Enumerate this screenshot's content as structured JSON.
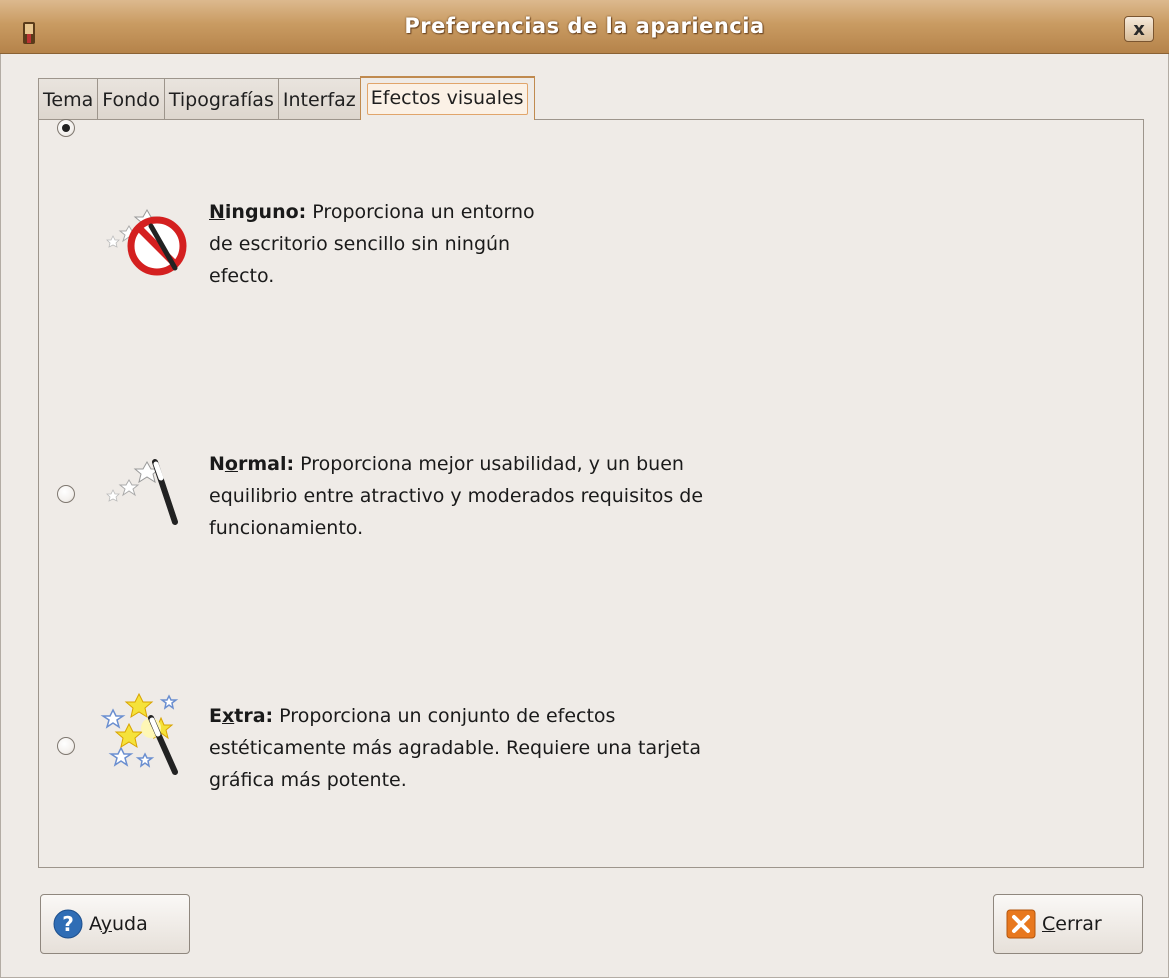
{
  "window": {
    "title": "Preferencias de la apariencia",
    "close_label": "x"
  },
  "tabs": [
    {
      "label": "Tema"
    },
    {
      "label": "Fondo"
    },
    {
      "label": "Tipografías"
    },
    {
      "label": "Interfaz"
    },
    {
      "label": "Efectos visuales",
      "active": true
    }
  ],
  "options": [
    {
      "name_pre": "",
      "name_mnemonic": "N",
      "name_post": "inguno:",
      "lines": [
        "Proporciona un entorno",
        "de escritorio sencillo sin ningún",
        "efecto."
      ],
      "selected": true,
      "icon": "wand-disabled-icon"
    },
    {
      "name_pre": "N",
      "name_mnemonic": "o",
      "name_post": "rmal:",
      "lines": [
        "Proporciona mejor usabilidad, y un buen",
        "equilibrio entre atractivo y moderados requisitos de",
        "funcionamiento."
      ],
      "selected": false,
      "icon": "wand-normal-icon"
    },
    {
      "name_pre": "E",
      "name_mnemonic": "x",
      "name_post": "tra:",
      "lines": [
        "Proporciona un conjunto de efectos",
        "estéticamente más agradable. Requiere una tarjeta",
        "gráfica más potente."
      ],
      "selected": false,
      "icon": "wand-extra-icon"
    }
  ],
  "buttons": {
    "help": {
      "pre": "A",
      "mnemonic": "y",
      "post": "uda",
      "icon": "help-icon"
    },
    "close": {
      "pre": "",
      "mnemonic": "C",
      "post": "errar",
      "icon": "close-icon"
    }
  },
  "colors": {
    "titlebar": "#c99b62",
    "window_bg": "#efebe7",
    "active_tab_accent": "#e1a56b",
    "close_icon": "#e8781e",
    "help_icon": "#2f6db5"
  }
}
